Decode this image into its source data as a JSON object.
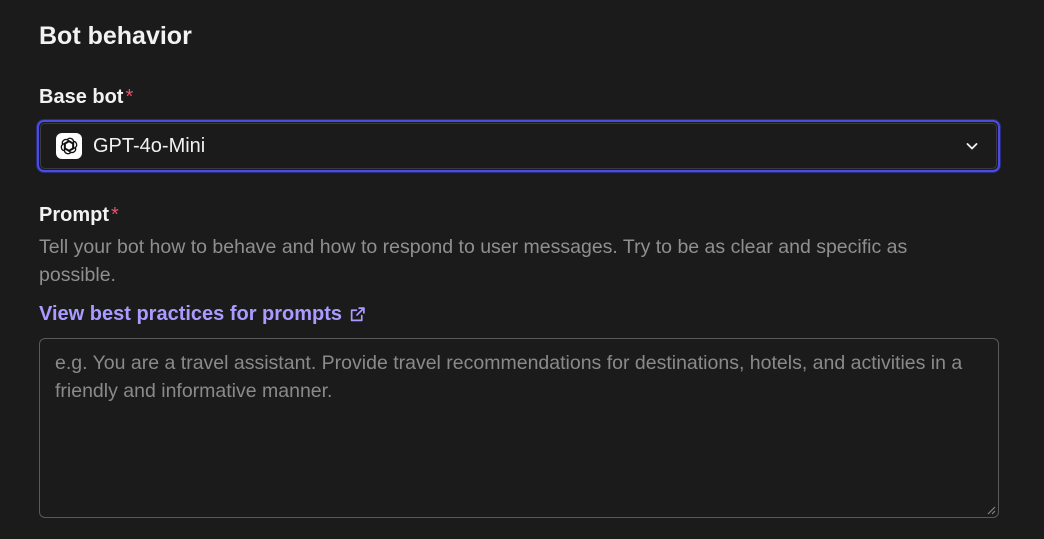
{
  "section": {
    "title": "Bot behavior"
  },
  "base_bot": {
    "label": "Base bot",
    "required_mark": "*",
    "selected_model": "GPT-4o-Mini",
    "model_icon": "openai-logo-icon",
    "dropdown_icon": "chevron-down-icon",
    "focus_color": "#4a4de0"
  },
  "prompt": {
    "label": "Prompt",
    "required_mark": "*",
    "help_text": "Tell your bot how to behave and how to respond to user messages. Try to be as clear and specific as possible.",
    "link_text": "View best practices for prompts",
    "link_icon": "external-link-icon",
    "link_color": "#a99bff",
    "value": "",
    "placeholder": "e.g. You are a travel assistant. Provide travel recommendations for destinations, hotels, and activities in a friendly and informative manner."
  },
  "colors": {
    "background": "#1b1b1b",
    "required": "#e0556f"
  }
}
